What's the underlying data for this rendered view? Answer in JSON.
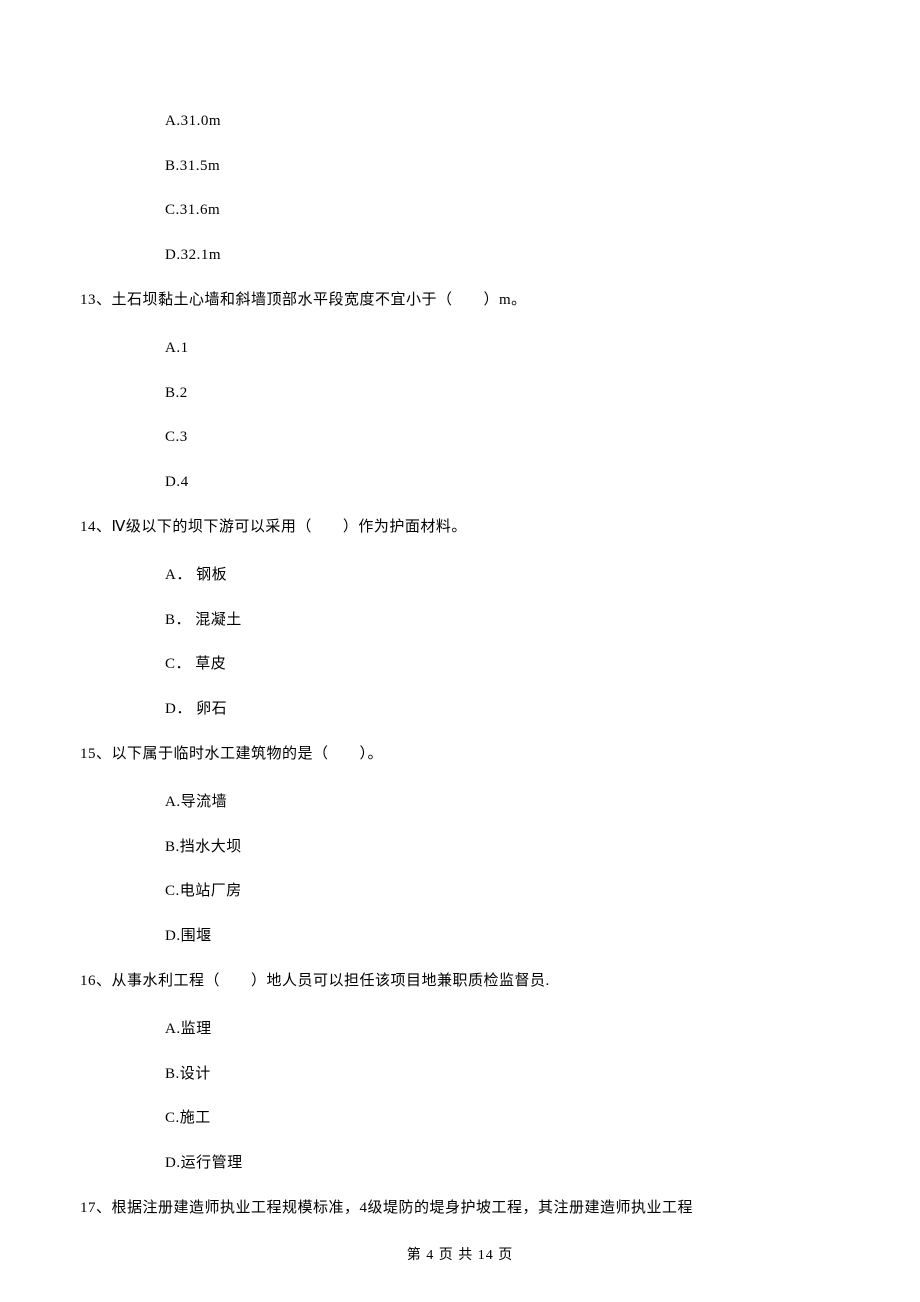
{
  "q12_tail_options": [
    {
      "label": "A.31.0m"
    },
    {
      "label": "B.31.5m"
    },
    {
      "label": "C.31.6m"
    },
    {
      "label": "D.32.1m"
    }
  ],
  "q13": {
    "num": "13、",
    "text": "土石坝黏土心墙和斜墙顶部水平段宽度不宜小于（　　）m。",
    "options": [
      {
        "label": "A.1"
      },
      {
        "label": "B.2"
      },
      {
        "label": "C.3"
      },
      {
        "label": "D.4"
      }
    ]
  },
  "q14": {
    "num": "14、",
    "text": "Ⅳ级以下的坝下游可以采用（　　）作为护面材料。",
    "options": [
      {
        "label": "A． 钢板"
      },
      {
        "label": "B． 混凝土"
      },
      {
        "label": "C． 草皮"
      },
      {
        "label": "D． 卵石"
      }
    ]
  },
  "q15": {
    "num": "15、",
    "text": "以下属于临时水工建筑物的是（　　）。",
    "options": [
      {
        "label": "A.导流墙"
      },
      {
        "label": "B.挡水大坝"
      },
      {
        "label": "C.电站厂房"
      },
      {
        "label": "D.围堰"
      }
    ]
  },
  "q16": {
    "num": "16、",
    "text": "从事水利工程（　　）地人员可以担任该项目地兼职质检监督员.",
    "options": [
      {
        "label": "A.监理"
      },
      {
        "label": "B.设计"
      },
      {
        "label": "C.施工"
      },
      {
        "label": "D.运行管理"
      }
    ]
  },
  "q17": {
    "num": "17、",
    "text": "根据注册建造师执业工程规模标准，4级堤防的堤身护坡工程，其注册建造师执业工程"
  },
  "footer": "第 4 页 共 14 页"
}
